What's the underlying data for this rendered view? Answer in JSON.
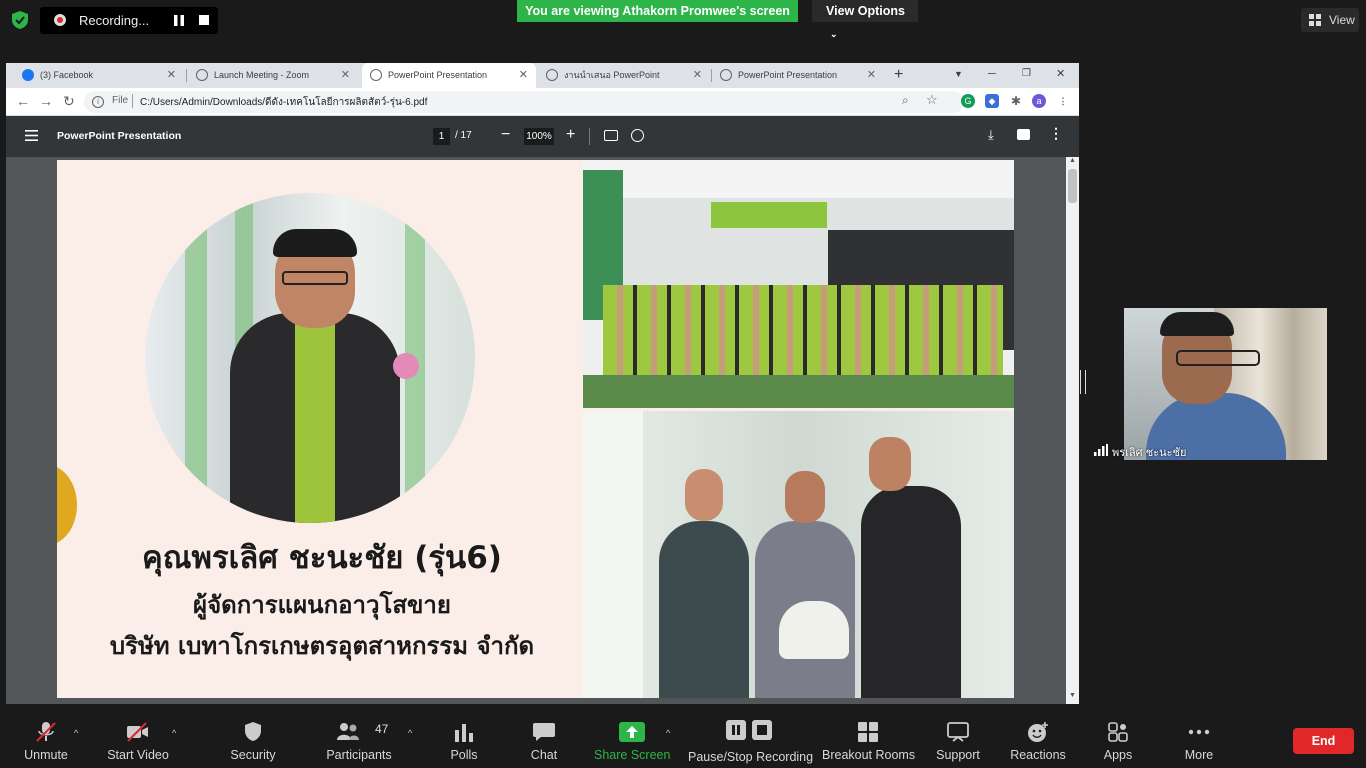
{
  "zoom_top": {
    "recording_label": "Recording...",
    "viewing_banner": "You are viewing Athakorn Promwee's screen",
    "view_options_label": "View Options",
    "view_label": "View"
  },
  "browser": {
    "tabs": [
      {
        "label": "(3) Facebook",
        "icon": "facebook-icon"
      },
      {
        "label": "Launch Meeting - Zoom",
        "icon": "globe-icon"
      },
      {
        "label": "PowerPoint Presentation",
        "icon": "globe-icon",
        "active": true
      },
      {
        "label": "งานนำเสนอ PowerPoint",
        "icon": "globe-icon"
      },
      {
        "label": "PowerPoint Presentation",
        "icon": "globe-icon"
      }
    ],
    "url_scheme": "File",
    "url": "C:/Users/Admin/Downloads/ดีดัง-เทคโนโลยีการผลิตสัตว์-รุ่น-6.pdf"
  },
  "pdf": {
    "title": "PowerPoint Presentation",
    "page_current": "1",
    "page_total": "/ 17",
    "zoom": "100%"
  },
  "slide": {
    "name_line": "คุณพรเลิศ ชะนะชัย (รุ่น6)",
    "role_line": "ผู้จัดการแผนกอาวุโสขาย",
    "company_line": "บริษัท เบทาโกรเกษตรอุตสาหกรรม จำกัด"
  },
  "participant": {
    "name": "พรเลิศ ชะนะชัย"
  },
  "toolbar": {
    "unmute": "Unmute",
    "start_video": "Start Video",
    "security": "Security",
    "participants": "Participants",
    "participants_count": "47",
    "polls": "Polls",
    "chat": "Chat",
    "share_screen": "Share Screen",
    "pause_stop_recording": "Pause/Stop Recording",
    "breakout_rooms": "Breakout Rooms",
    "support": "Support",
    "reactions": "Reactions",
    "apps": "Apps",
    "more": "More",
    "end": "End"
  },
  "colors": {
    "zoom_green": "#2db54a",
    "end_red": "#e02828",
    "pdf_toolbar": "#323639"
  }
}
